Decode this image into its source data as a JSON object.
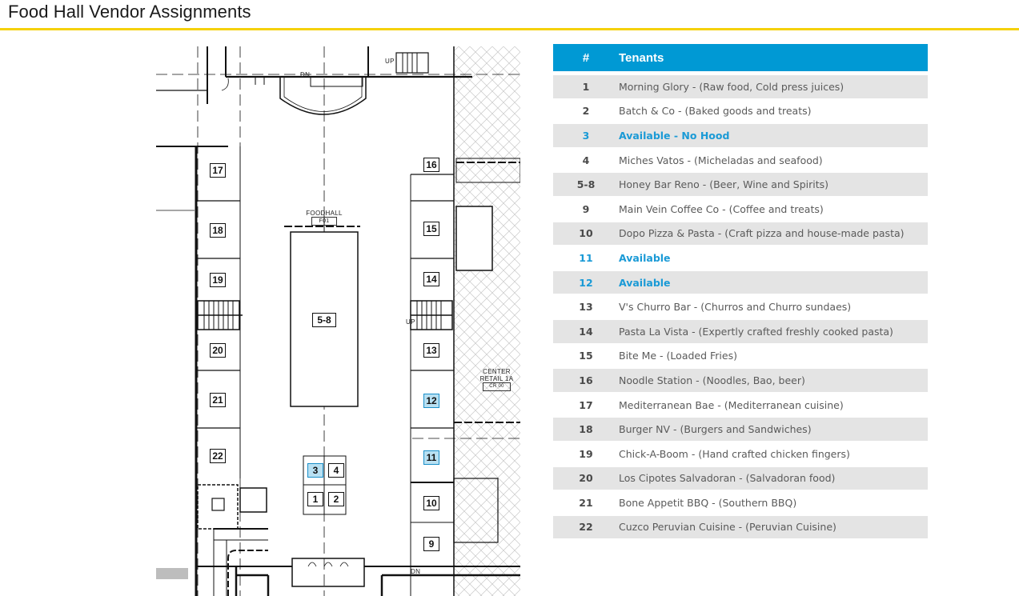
{
  "page": {
    "title": "Food Hall Vendor Assignments",
    "accent_color": "#f5d10a",
    "header_color": "#0099d4",
    "available_color": "#1a9ad6"
  },
  "floor_plan": {
    "labels": {
      "foodhall": "FOODHALL",
      "foodhall_code": "F01",
      "center_retail": "CENTER",
      "center_retail_2": "RETAIL 1A",
      "center_retail_code": "CR 00",
      "up": "UP",
      "dn": "DN"
    },
    "stalls": [
      {
        "id": "17",
        "available": false
      },
      {
        "id": "16",
        "available": false
      },
      {
        "id": "18",
        "available": false
      },
      {
        "id": "15",
        "available": false
      },
      {
        "id": "19",
        "available": false
      },
      {
        "id": "14",
        "available": false
      },
      {
        "id": "5-8",
        "available": false
      },
      {
        "id": "20",
        "available": false
      },
      {
        "id": "13",
        "available": false
      },
      {
        "id": "21",
        "available": false
      },
      {
        "id": "12",
        "available": true
      },
      {
        "id": "22",
        "available": false
      },
      {
        "id": "11",
        "available": true
      },
      {
        "id": "3",
        "available": true
      },
      {
        "id": "4",
        "available": false
      },
      {
        "id": "1",
        "available": false
      },
      {
        "id": "2",
        "available": false
      },
      {
        "id": "10",
        "available": false
      },
      {
        "id": "9",
        "available": false
      }
    ]
  },
  "table": {
    "headers": {
      "number": "#",
      "tenants": "Tenants"
    },
    "rows": [
      {
        "num": "1",
        "tenant": "Morning Glory - (Raw food, Cold press juices)",
        "available": false
      },
      {
        "num": "2",
        "tenant": "Batch & Co - (Baked goods and treats)",
        "available": false
      },
      {
        "num": "3",
        "tenant": "Available - No Hood",
        "available": true
      },
      {
        "num": "4",
        "tenant": "Miches Vatos - (Micheladas and seafood)",
        "available": false
      },
      {
        "num": "5-8",
        "tenant": "Honey Bar Reno - (Beer, Wine and Spirits)",
        "available": false
      },
      {
        "num": "9",
        "tenant": "Main Vein Coffee Co - (Coffee and treats)",
        "available": false
      },
      {
        "num": "10",
        "tenant": "Dopo Pizza & Pasta - (Craft pizza and house-made pasta)",
        "available": false
      },
      {
        "num": "11",
        "tenant": "Available",
        "available": true
      },
      {
        "num": "12",
        "tenant": "Available",
        "available": true
      },
      {
        "num": "13",
        "tenant": "V's Churro Bar - (Churros and Churro sundaes)",
        "available": false
      },
      {
        "num": "14",
        "tenant": "Pasta La Vista - (Expertly crafted freshly cooked pasta)",
        "available": false
      },
      {
        "num": "15",
        "tenant": "Bite Me - (Loaded Fries)",
        "available": false
      },
      {
        "num": "16",
        "tenant": "Noodle Station - (Noodles, Bao, beer)",
        "available": false
      },
      {
        "num": "17",
        "tenant": "Mediterranean Bae - (Mediterranean cuisine)",
        "available": false
      },
      {
        "num": "18",
        "tenant": "Burger NV - (Burgers and Sandwiches)",
        "available": false
      },
      {
        "num": "19",
        "tenant": "Chick-A-Boom - (Hand crafted chicken fingers)",
        "available": false
      },
      {
        "num": "20",
        "tenant": "Los Cipotes Salvadoran - (Salvadoran food)",
        "available": false
      },
      {
        "num": "21",
        "tenant": "Bone Appetit BBQ - (Southern BBQ)",
        "available": false
      },
      {
        "num": "22",
        "tenant": "Cuzco Peruvian Cuisine - (Peruvian Cuisine)",
        "available": false
      }
    ]
  }
}
